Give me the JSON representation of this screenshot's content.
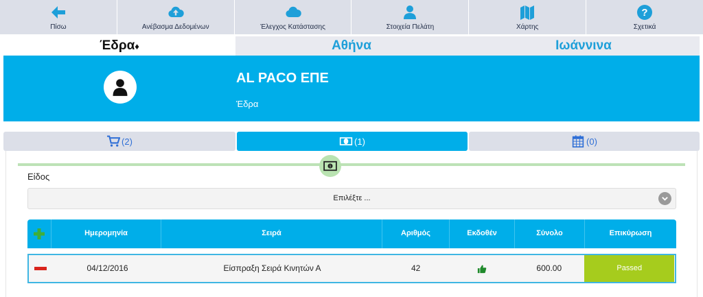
{
  "toolbar": {
    "items": [
      {
        "label": "Πίσω",
        "icon": "arrow-left-icon"
      },
      {
        "label": "Ανέβασμα Δεδομένων",
        "icon": "cloud-upload-icon"
      },
      {
        "label": "Έλεγχος Κατάστασης",
        "icon": "cloud-icon"
      },
      {
        "label": "Στοιχεία Πελάτη",
        "icon": "user-icon"
      },
      {
        "label": "Χάρτης",
        "icon": "map-icon"
      },
      {
        "label": "Σχετικά",
        "icon": "question-icon"
      }
    ],
    "icon_color": "#1e9fd9"
  },
  "branch_tabs": [
    {
      "label": "Έδρα",
      "active": true,
      "icon": "tag-icon"
    },
    {
      "label": "Αθήνα",
      "active": false
    },
    {
      "label": "Ιωάννινα",
      "active": false
    }
  ],
  "banner": {
    "client_name": "AL PACO ΕΠΕ",
    "branch": "Έδρα",
    "color": "#00aee9"
  },
  "section_tabs": [
    {
      "count": "(2)",
      "icon": "cart-icon",
      "active": false
    },
    {
      "count": "(1)",
      "icon": "money-icon",
      "active": true
    },
    {
      "count": "(0)",
      "icon": "calendar-icon",
      "active": false
    }
  ],
  "form": {
    "item_label": "Είδος",
    "select_value": "Επιλέξτε ..."
  },
  "table": {
    "headers": [
      "Ημερομηνία",
      "Σειρά",
      "Αριθμός",
      "Εκδοθέν",
      "Σύνολο",
      "Επικύρωση"
    ],
    "rows": [
      {
        "date": "04/12/2016",
        "series": "Είσπραξη Σειρά Κινητών Α",
        "number": "42",
        "issued": "thumbs-up-icon",
        "total": "600.00",
        "status": "Passed"
      }
    ],
    "status_color": "#a6cc1d"
  }
}
